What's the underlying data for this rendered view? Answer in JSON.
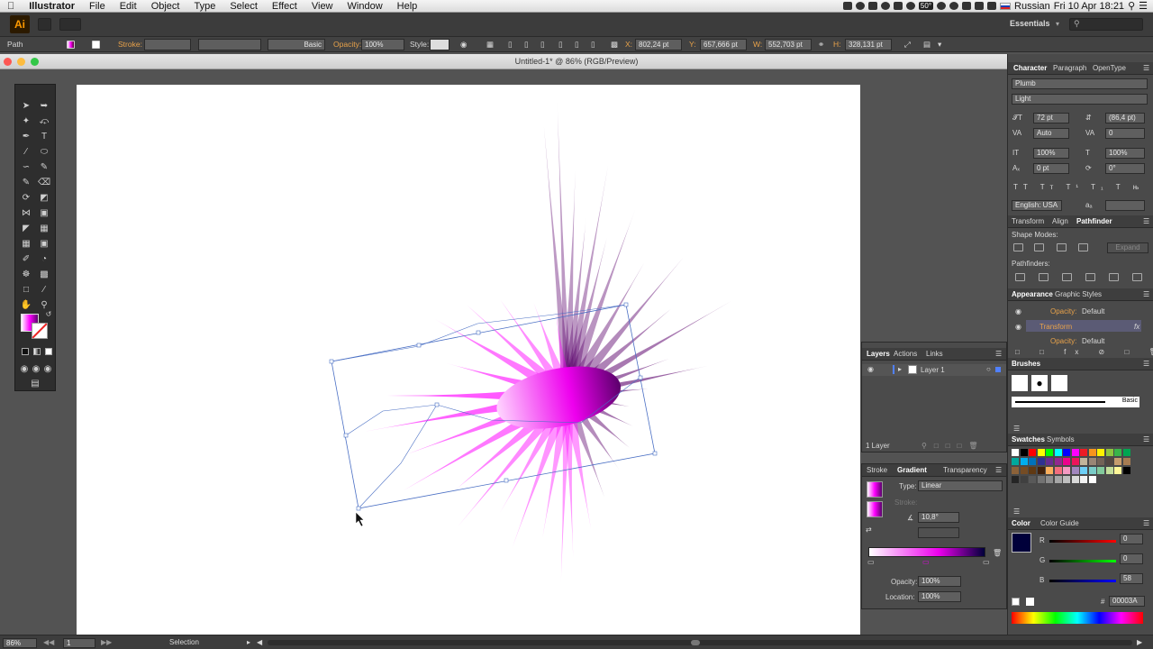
{
  "menubar": {
    "app_name": "Illustrator",
    "items": [
      "File",
      "Edit",
      "Object",
      "Type",
      "Select",
      "Effect",
      "View",
      "Window",
      "Help"
    ],
    "temperature": "50°",
    "keyboard": "Russian",
    "datetime": "Fri 10 Apr 18:21"
  },
  "appbar": {
    "logo": "Ai",
    "workspace": "Essentials",
    "search_placeholder": ""
  },
  "control": {
    "selection_type": "Path",
    "stroke_label": "Stroke:",
    "brush_label": "Basic",
    "opacity_label": "Opacity:",
    "opacity_value": "100%",
    "style_label": "Style:",
    "x_label": "X:",
    "x_value": "802,24 pt",
    "y_label": "Y:",
    "y_value": "657,666 pt",
    "w_label": "W:",
    "w_value": "552,703 pt",
    "h_label": "H:",
    "h_value": "328,131 pt"
  },
  "document": {
    "title": "Untitled-1* @ 86% (RGB/Preview)"
  },
  "character": {
    "tabs": [
      "Character",
      "Paragraph",
      "OpenType"
    ],
    "font_family": "Plumb",
    "font_style": "Light",
    "size": "72 pt",
    "leading": "(86,4 pt)",
    "kerning": "Auto",
    "tracking": "0",
    "vscale": "100%",
    "hscale": "100%",
    "baseline": "0 pt",
    "rotation": "0°",
    "language": "English: USA",
    "aa": "aₐ"
  },
  "pathfinder": {
    "tabs": [
      "Transform",
      "Align",
      "Pathfinder"
    ],
    "shape_modes_label": "Shape Modes:",
    "expand_label": "Expand",
    "pathfinders_label": "Pathfinders:"
  },
  "appearance": {
    "tabs": [
      "Appearance",
      "Graphic Styles"
    ],
    "rows": [
      {
        "label": "Opacity:",
        "value": "Default"
      },
      {
        "label": "Transform",
        "value": "fx"
      },
      {
        "label": "Opacity:",
        "value": "Default"
      }
    ]
  },
  "brushes": {
    "tabs": [
      "Brushes"
    ],
    "basic_label": "Basic"
  },
  "swatches": {
    "tabs": [
      "Swatches",
      "Symbols"
    ],
    "colors": [
      "#ffffff",
      "#000000",
      "#ff0000",
      "#ffff00",
      "#00ff00",
      "#00ffff",
      "#0000ff",
      "#ff00ff",
      "#ed1c24",
      "#f7941d",
      "#fff200",
      "#8dc63f",
      "#39b54a",
      "#00a651",
      "#00a99d",
      "#00aeef",
      "#0072bc",
      "#2e3192",
      "#662d91",
      "#92278f",
      "#ec008c",
      "#ed145b",
      "#c2b59b",
      "#998675",
      "#736357",
      "#534741",
      "#c69c6d",
      "#a67c52",
      "#8c6239",
      "#754c24",
      "#603913",
      "#42210b",
      "#fbaf5d",
      "#f26d7d",
      "#f49ac2",
      "#a186be",
      "#6dcff6",
      "#7accc8",
      "#82ca9c",
      "#c4df9b",
      "#fff799",
      "#000000",
      "#252525",
      "#404040",
      "#595959",
      "#737373",
      "#8c8c8c",
      "#a6a6a6",
      "#bfbfbf",
      "#d9d9d9",
      "#f2f2f2",
      "#ffffff"
    ]
  },
  "color": {
    "tabs": [
      "Color",
      "Color Guide"
    ],
    "r": "0",
    "g": "0",
    "b": "58",
    "hex": "00003A",
    "r_label": "R",
    "g_label": "G",
    "b_label": "B",
    "hex_label": "#",
    "current": "#00003a"
  },
  "layers": {
    "tabs": [
      "Layers",
      "Actions",
      "Links"
    ],
    "layer_name": "Layer 1",
    "count_label": "1 Layer"
  },
  "gradient": {
    "tabs": [
      "Stroke",
      "Gradient",
      "Transparency"
    ],
    "type_label": "Type:",
    "type_value": "Linear",
    "stroke_label": "Stroke:",
    "angle_value": "10,8°",
    "opacity_label": "Opacity:",
    "opacity_value": "100%",
    "location_label": "Location:",
    "location_value": "100%"
  },
  "status": {
    "zoom": "86%",
    "artboard": "1",
    "tool": "Selection"
  },
  "colors": {
    "magenta": "#ff00ff",
    "deep_purple": "#5a006b",
    "orange_label": "#e8a24a",
    "selection": "#4a6fc4"
  }
}
